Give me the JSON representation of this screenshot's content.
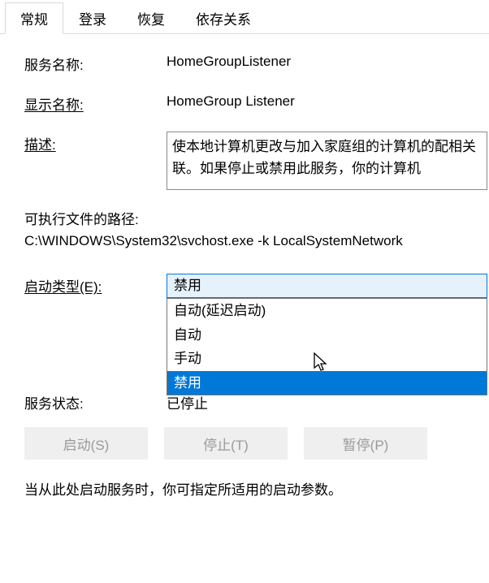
{
  "tabs": {
    "general": "常规",
    "logon": "登录",
    "recovery": "恢复",
    "dependencies": "依存关系"
  },
  "labels": {
    "service_name": "服务名称:",
    "display_name": "显示名称:",
    "description": "描述:",
    "exec_path": "可执行文件的路径:",
    "startup_type": "启动类型(E):",
    "service_status": "服务状态:"
  },
  "values": {
    "service_name": "HomeGroupListener",
    "display_name": "HomeGroup Listener",
    "description": "使本地计算机更改与加入家庭组的计算机的配相关联。如果停止或禁用此服务，你的计算机",
    "exec_path": "C:\\WINDOWS\\System32\\svchost.exe -k LocalSystemNetwork",
    "status": "已停止"
  },
  "startup": {
    "selected": "禁用",
    "options": [
      "自动(延迟启动)",
      "自动",
      "手动",
      "禁用"
    ]
  },
  "buttons": {
    "start": "启动(S)",
    "stop": "停止(T)",
    "pause": "暂停(P)"
  },
  "note": "当从此处启动服务时，你可指定所适用的启动参数。"
}
